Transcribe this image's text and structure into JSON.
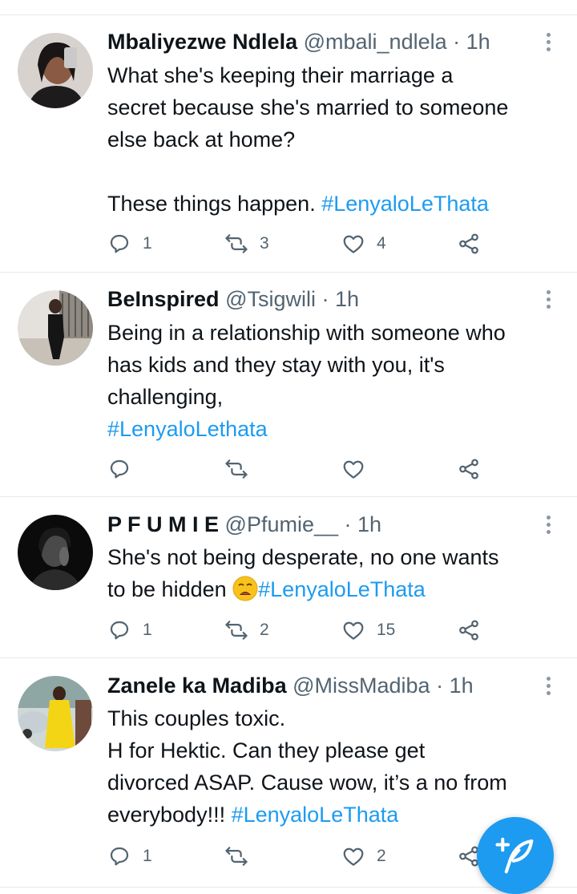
{
  "tweets": [
    {
      "name": "Mbaliyezwe Ndlela",
      "handle": "@mbali_ndlela",
      "sep": " · ",
      "time": "1h",
      "lines": [
        "What she's keeping their marriage a",
        "secret because she's married to someone",
        "else back at home?"
      ],
      "line2_text": "These things happen. ",
      "hashtag": "#LenyaloLeThata",
      "replies": "1",
      "retweets": "3",
      "likes": "4"
    },
    {
      "name": "BeInspired",
      "handle": "@Tsigwili",
      "sep": " · ",
      "time": "1h",
      "lines": [
        "Being in a relationship with someone who",
        "has kids and they stay with you, it's",
        "challenging,"
      ],
      "hashtag": "#LenyaloLethata",
      "replies": "",
      "retweets": "",
      "likes": ""
    },
    {
      "name": "P F U M I E",
      "handle": "@Pfumie__",
      "sep": " · ",
      "time": "1h",
      "lines": [
        "She's not being desperate, no one wants"
      ],
      "line2_text": "to be hidden ",
      "hashtag": "#LenyaloLeThata",
      "replies": "1",
      "retweets": "2",
      "likes": "15"
    },
    {
      "name": "Zanele ka Madiba",
      "handle": "@MissMadiba",
      "sep": " · ",
      "time": "1h",
      "lines": [
        "This couples toxic.",
        "H for Hektic. Can they please get",
        "divorced ASAP. Cause wow, it’s a no from"
      ],
      "line2_text": "everybody!!! ",
      "hashtag": "#LenyaloLeThata",
      "replies": "1",
      "retweets": "",
      "likes": "2"
    }
  ],
  "icons": {
    "reply": "reply-icon",
    "retweet": "retweet-icon",
    "like": "heart-icon",
    "share": "share-icon",
    "more": "more-icon",
    "compose": "compose-tweet-icon"
  },
  "colors": {
    "accent": "#1d9bf0",
    "text": "#0f1419",
    "muted": "#536471",
    "divider": "#e6e9eb"
  }
}
